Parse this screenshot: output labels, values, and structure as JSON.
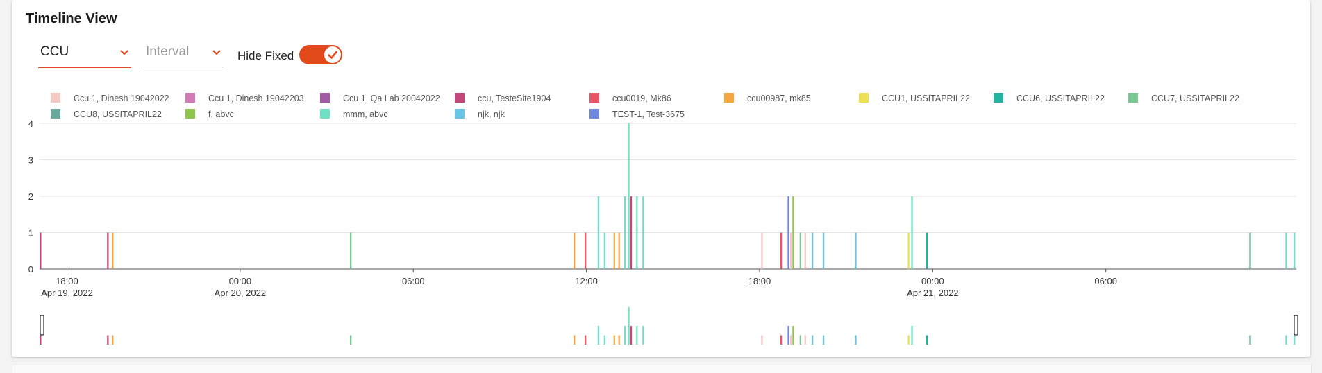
{
  "header": {
    "title": "Timeline View"
  },
  "controls": {
    "group_select_value": "CCU",
    "interval_select_placeholder": "Interval",
    "hide_fixed_label": "Hide Fixed",
    "hide_fixed_on": true
  },
  "chart_data": {
    "type": "bar",
    "ylim": [
      0,
      4
    ],
    "y_ticks": [
      0,
      1,
      2,
      3,
      4
    ],
    "x_start": "2022-04-19T17:03",
    "x_end": "2022-04-21T12:36",
    "x_ticks": [
      {
        "t": "2022-04-19T18:00",
        "label": "18:00",
        "date": "Apr 19, 2022"
      },
      {
        "t": "2022-04-20T00:00",
        "label": "00:00",
        "date": "Apr 20, 2022"
      },
      {
        "t": "2022-04-20T06:00",
        "label": "06:00",
        "date": ""
      },
      {
        "t": "2022-04-20T12:00",
        "label": "12:00",
        "date": ""
      },
      {
        "t": "2022-04-20T18:00",
        "label": "18:00",
        "date": ""
      },
      {
        "t": "2022-04-21T00:00",
        "label": "00:00",
        "date": "Apr 21, 2022"
      },
      {
        "t": "2022-04-21T06:00",
        "label": "06:00",
        "date": ""
      }
    ],
    "grid": true,
    "legend_position": "top",
    "series": [
      {
        "name": "Ccu 1, Dinesh 19042022",
        "color": "#f4c8c3"
      },
      {
        "name": "Ccu 1, Dinesh 19042203",
        "color": "#d27ab6"
      },
      {
        "name": "Ccu 1, Qa Lab 20042022",
        "color": "#a05aa6"
      },
      {
        "name": "ccu, TesteSite1904",
        "color": "#c4467a"
      },
      {
        "name": "ccu0019, Mk86",
        "color": "#e85565"
      },
      {
        "name": "ccu00987, mk85",
        "color": "#f6a641"
      },
      {
        "name": "CCU1, USSITAPRIL22",
        "color": "#ede055"
      },
      {
        "name": "CCU6, USSITAPRIL22",
        "color": "#1fb3a0"
      },
      {
        "name": "CCU7, USSITAPRIL22",
        "color": "#79c792"
      },
      {
        "name": "CCU8, USSITAPRIL22",
        "color": "#6aa89e"
      },
      {
        "name": "f, abvc",
        "color": "#8ec44b"
      },
      {
        "name": "mmm, abvc",
        "color": "#6fe0c6"
      },
      {
        "name": "njk, njk",
        "color": "#68c6e6"
      },
      {
        "name": "TEST-1, Test-3675",
        "color": "#7088dd"
      }
    ],
    "bars": [
      {
        "t": "2022-04-19T17:05",
        "v": 1,
        "s": 3
      },
      {
        "t": "2022-04-19T19:25",
        "v": 1,
        "s": 3
      },
      {
        "t": "2022-04-19T19:35",
        "v": 1,
        "s": 5
      },
      {
        "t": "2022-04-20T03:50",
        "v": 1,
        "s": 8
      },
      {
        "t": "2022-04-20T11:35",
        "v": 1,
        "s": 5
      },
      {
        "t": "2022-04-20T11:58",
        "v": 1,
        "s": 4
      },
      {
        "t": "2022-04-20T12:25",
        "v": 2,
        "s": 11
      },
      {
        "t": "2022-04-20T12:38",
        "v": 1,
        "s": 11
      },
      {
        "t": "2022-04-20T12:58",
        "v": 1,
        "s": 5
      },
      {
        "t": "2022-04-20T13:08",
        "v": 1,
        "s": 5
      },
      {
        "t": "2022-04-20T13:20",
        "v": 2,
        "s": 11
      },
      {
        "t": "2022-04-20T13:28",
        "v": 4,
        "s": 11
      },
      {
        "t": "2022-04-20T13:33",
        "v": 2,
        "s": 3
      },
      {
        "t": "2022-04-20T13:45",
        "v": 2,
        "s": 11
      },
      {
        "t": "2022-04-20T13:58",
        "v": 2,
        "s": 11
      },
      {
        "t": "2022-04-20T18:05",
        "v": 1,
        "s": 0
      },
      {
        "t": "2022-04-20T18:45",
        "v": 1,
        "s": 4
      },
      {
        "t": "2022-04-20T19:00",
        "v": 2,
        "s": 13
      },
      {
        "t": "2022-04-20T19:05",
        "v": 1,
        "s": 0
      },
      {
        "t": "2022-04-20T19:10",
        "v": 2,
        "s": 10
      },
      {
        "t": "2022-04-20T19:25",
        "v": 1,
        "s": 8
      },
      {
        "t": "2022-04-20T19:35",
        "v": 1,
        "s": 0
      },
      {
        "t": "2022-04-20T19:50",
        "v": 1,
        "s": 12
      },
      {
        "t": "2022-04-20T20:13",
        "v": 1,
        "s": 12
      },
      {
        "t": "2022-04-20T21:20",
        "v": 1,
        "s": 12
      },
      {
        "t": "2022-04-20T23:10",
        "v": 1,
        "s": 6
      },
      {
        "t": "2022-04-20T23:17",
        "v": 2,
        "s": 11
      },
      {
        "t": "2022-04-20T23:48",
        "v": 1,
        "s": 7
      },
      {
        "t": "2022-04-21T11:00",
        "v": 1,
        "s": 9
      },
      {
        "t": "2022-04-21T12:15",
        "v": 1,
        "s": 11
      },
      {
        "t": "2022-04-21T12:32",
        "v": 1,
        "s": 11
      }
    ]
  },
  "icons": {
    "select_chevron": "chevron-down-icon",
    "toggle_check": "check-icon"
  }
}
